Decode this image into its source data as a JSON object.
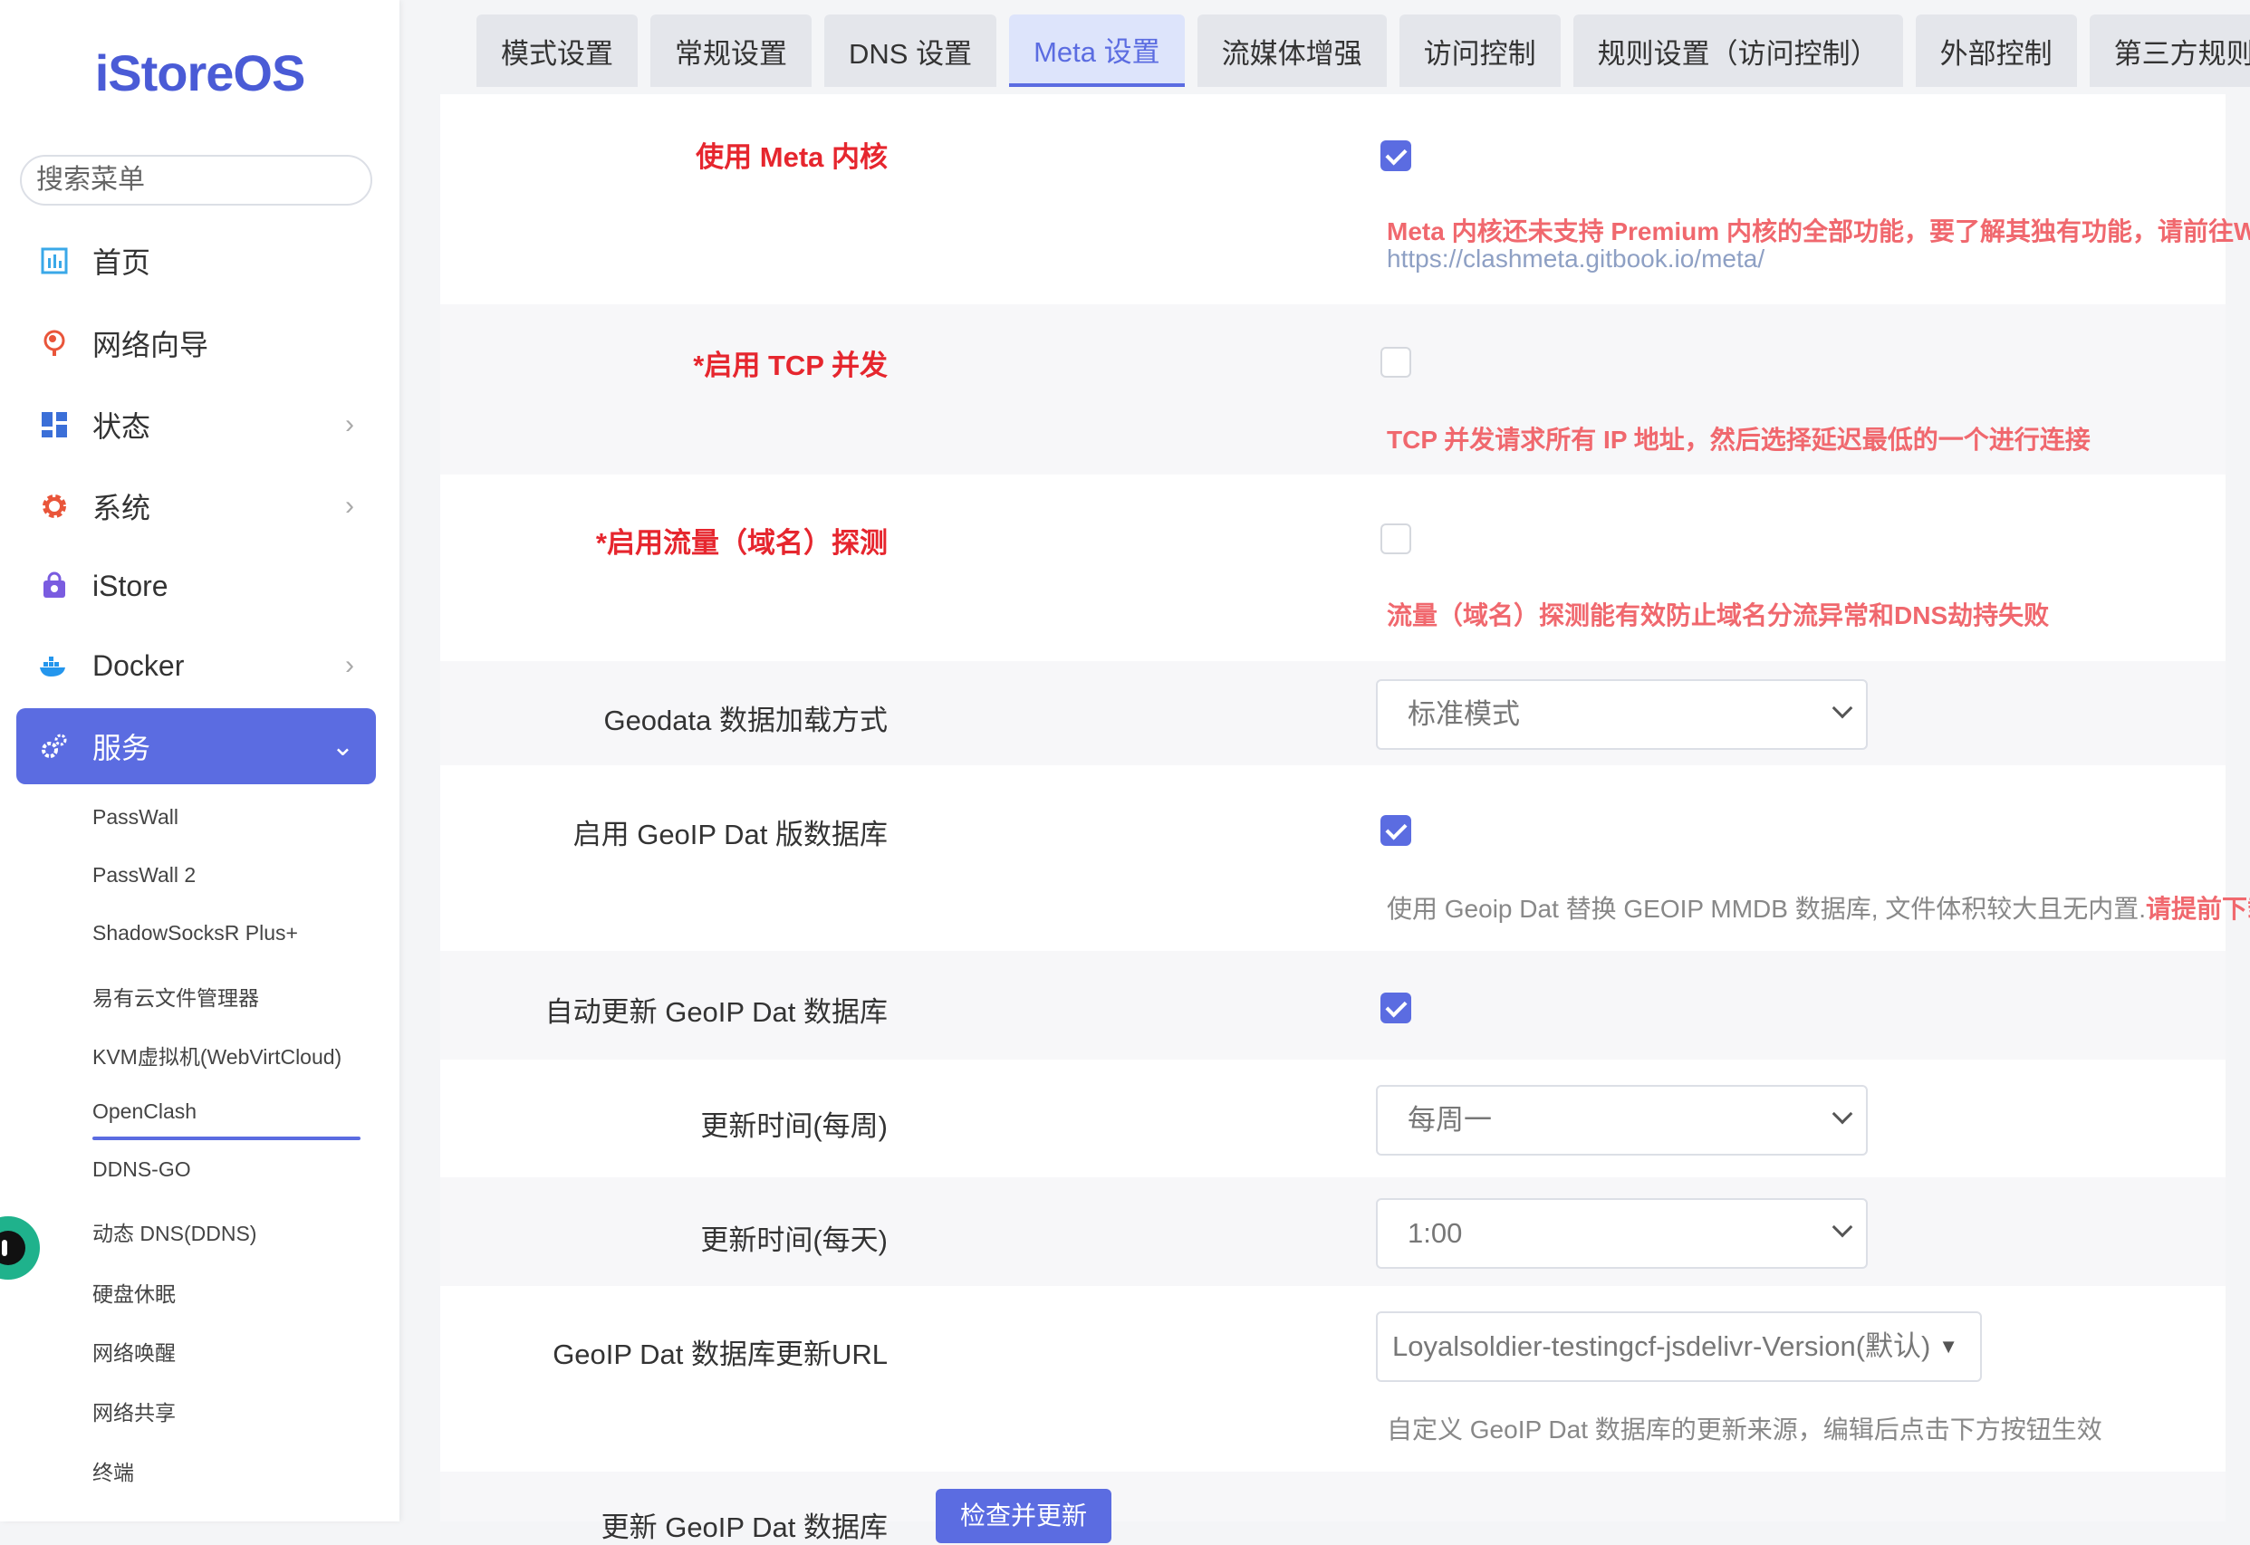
{
  "app": {
    "logo": "iStoreOS"
  },
  "sidebar": {
    "search_placeholder": "搜索菜单",
    "items": [
      {
        "label": "首页",
        "icon": "bar-chart-icon"
      },
      {
        "label": "网络向导",
        "icon": "globe-icon"
      },
      {
        "label": "状态",
        "icon": "dashboard-grid-icon"
      },
      {
        "label": "系统",
        "icon": "gear-icon"
      },
      {
        "label": "iStore",
        "icon": "shopping-bag-icon"
      },
      {
        "label": "Docker",
        "icon": "docker-whale-icon"
      },
      {
        "label": "服务",
        "icon": "gears-icon"
      }
    ],
    "sub_items": [
      "PassWall",
      "PassWall 2",
      "ShadowSocksR Plus+",
      "易有云文件管理器",
      "KVM虚拟机(WebVirtCloud)",
      "OpenClash",
      "DDNS-GO",
      "动态 DNS(DDNS)",
      "硬盘休眠",
      "网络唤醒",
      "网络共享",
      "终端"
    ],
    "active_sub": "OpenClash",
    "accent": "#5b6ce1"
  },
  "tabs": [
    "模式设置",
    "常规设置",
    "DNS 设置",
    "Meta 设置",
    "流媒体增强",
    "访问控制",
    "规则设置（访问控制）",
    "外部控制",
    "第三方规则订"
  ],
  "active_tab": "Meta 设置",
  "settings": {
    "meta_core": {
      "label": "使用 Meta 内核",
      "checked": true,
      "desc": "Meta 内核还未支持 Premium 内核的全部功能，要了解其独有功能，请前往Wiki:",
      "link": "https://clashmeta.gitbook.io/meta/"
    },
    "tcp_concurrent": {
      "label": "*启用 TCP 并发",
      "checked": false,
      "desc": "TCP 并发请求所有 IP 地址，然后选择延迟最低的一个进行连接"
    },
    "sniffer": {
      "label": "*启用流量（域名）探测",
      "checked": false,
      "desc": "流量（域名）探测能有效防止域名分流异常和DNS劫持失败"
    },
    "geodata_mode": {
      "label": "Geodata 数据加载方式",
      "value": "标准模式"
    },
    "geoip_dat": {
      "label": "启用 GeoIP Dat 版数据库",
      "checked": true,
      "desc": "使用 Geoip Dat 替换 GEOIP MMDB 数据库, 文件体积较大且无内置.",
      "desc_strong": "请提前下载"
    },
    "auto_update": {
      "label": "自动更新 GeoIP Dat 数据库",
      "checked": true
    },
    "update_week": {
      "label": "更新时间(每周)",
      "value": "每周一"
    },
    "update_day": {
      "label": "更新时间(每天)",
      "value": "1:00"
    },
    "update_url": {
      "label": "GeoIP Dat 数据库更新URL",
      "value": "Loyalsoldier-testingcf-jsdelivr-Version(默认)",
      "desc": "自定义 GeoIP Dat 数据库的更新来源，编辑后点击下方按钮生效"
    },
    "update_now": {
      "label": "更新 GeoIP Dat 数据库",
      "button": "检查并更新"
    }
  }
}
